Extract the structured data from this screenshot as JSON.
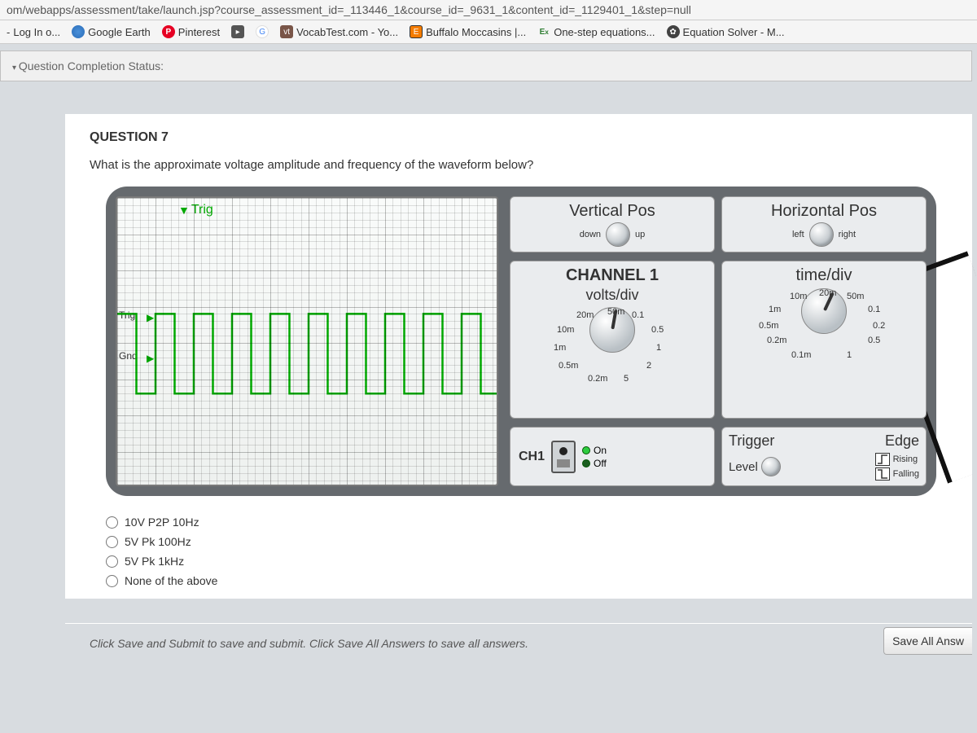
{
  "url": "om/webapps/assessment/take/launch.jsp?course_assessment_id=_113446_1&course_id=_9631_1&content_id=_1129401_1&step=null",
  "bookmarks": {
    "login": "Log In o...",
    "earth": "Google Earth",
    "pinterest": "Pinterest",
    "vocab": "VocabTest.com - Yo...",
    "moccasins": "Buffalo Moccasins |...",
    "onestep": "One-step equations...",
    "eqsolver": "Equation Solver - M..."
  },
  "completion_label": "Question Completion Status:",
  "question": {
    "title": "QUESTION 7",
    "prompt": "What is the approximate voltage amplitude and frequency of the waveform below?"
  },
  "scope": {
    "trig_top": "Trig",
    "trig_level": "Trig",
    "gnd": "Gnd",
    "vpos": {
      "title": "Vertical Pos",
      "left": "down",
      "right": "up"
    },
    "hpos": {
      "title": "Horizontal Pos",
      "left": "left",
      "right": "right"
    },
    "ch1": {
      "title": "CHANNEL 1",
      "sub": "volts/div",
      "labels": [
        "50m",
        "0.1",
        "0.5",
        "1",
        "2",
        "5",
        "0.2m",
        "0.5m",
        "1m",
        "10m",
        "20m"
      ]
    },
    "time": {
      "title": "time/div",
      "labels": [
        "20m",
        "50m",
        "0.1",
        "0.2",
        "0.5",
        "1",
        "0.1m",
        "0.2m",
        "0.5m",
        "1m",
        "10m"
      ]
    },
    "ch1_panel": {
      "name": "CH1",
      "on": "On",
      "off": "Off"
    },
    "trigger": {
      "title": "Trigger",
      "edge": "Edge",
      "level": "Level",
      "rising": "Rising",
      "falling": "Falling"
    }
  },
  "answers": {
    "a": "10V P2P 10Hz",
    "b": "5V Pk 100Hz",
    "c": "5V Pk 1kHz",
    "d": "None of the above"
  },
  "footer": {
    "hint": "Click Save and Submit to save and submit. Click Save All Answers to save all answers.",
    "save_all": "Save All Answ"
  }
}
